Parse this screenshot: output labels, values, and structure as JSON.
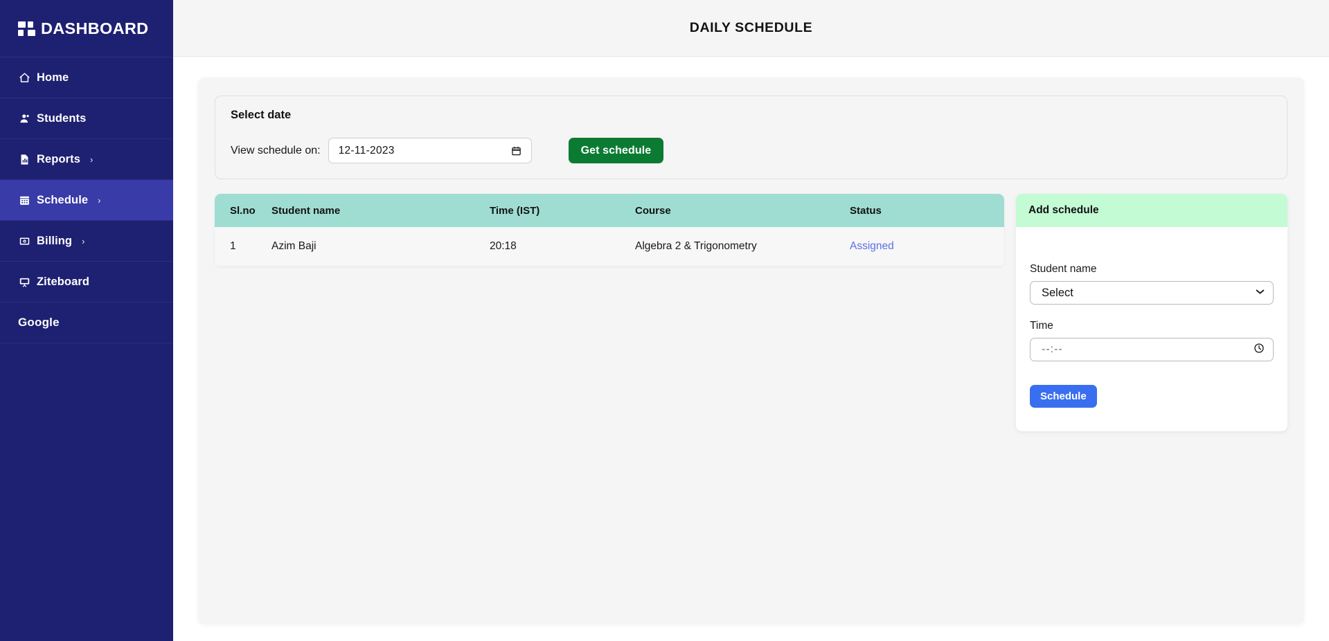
{
  "sidebar": {
    "brand": "DASHBOARD",
    "brand_logo_icon": "grid-logo-icon",
    "items": [
      {
        "label": "Home",
        "icon": "home-icon",
        "caret": "",
        "active": false
      },
      {
        "label": "Students",
        "icon": "user-icon",
        "caret": "",
        "active": false
      },
      {
        "label": "Reports",
        "icon": "report-icon",
        "caret": "›",
        "active": false
      },
      {
        "label": "Schedule",
        "icon": "calendar-icon",
        "caret": "›",
        "active": true
      },
      {
        "label": "Billing",
        "icon": "billing-icon",
        "caret": "›",
        "active": false
      },
      {
        "label": "Ziteboard",
        "icon": "whiteboard-icon",
        "caret": "",
        "active": false
      }
    ],
    "google_label": "Google"
  },
  "header": {
    "title": "DAILY SCHEDULE"
  },
  "date_panel": {
    "title": "Select date",
    "label": "View schedule on:",
    "date_value": "12-11-2023",
    "calendar_icon": "calendar-icon",
    "get_button": "Get schedule"
  },
  "table": {
    "columns": [
      "Sl.no",
      "Student name",
      "Time (IST)",
      "Course",
      "Status"
    ],
    "rows": [
      {
        "slno": "1",
        "student_name": "Azim Baji",
        "time": "20:18",
        "course": "Algebra 2 & Trigonometry",
        "status": "Assigned"
      }
    ]
  },
  "add_schedule": {
    "title": "Add schedule",
    "student_label": "Student name",
    "student_value": "Select",
    "student_chevron_icon": "chevron-down-icon",
    "time_label": "Time",
    "time_placeholder": "--:--",
    "time_icon": "clock-icon",
    "submit_label": "Schedule"
  },
  "colors": {
    "sidebar_bg": "#1e2071",
    "sidebar_active": "#383ba8",
    "table_header": "#9fddd3",
    "add_header": "#c3fbd4",
    "green_button": "#0b7b33",
    "blue_button": "#3a6ef0",
    "status_link": "#5a6fe8"
  }
}
